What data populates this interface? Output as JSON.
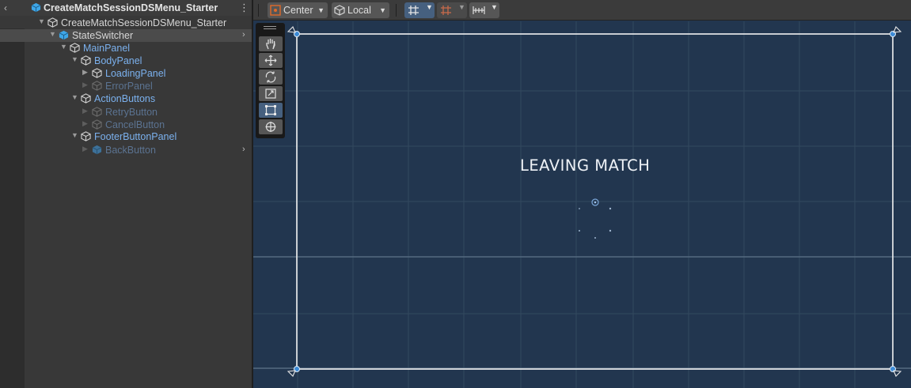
{
  "hierarchy": {
    "back_glyph": "‹",
    "title": "CreateMatchSessionDSMenu_Starter",
    "menu_glyph": "⋮",
    "rows": [
      {
        "label": "CreateMatchSessionDSMenu_Starter",
        "style": "white",
        "depth": 0,
        "prefab": false
      },
      {
        "label": "StateSwitcher",
        "style": "white",
        "depth": 1,
        "prefab": true,
        "selected": true
      },
      {
        "label": "MainPanel",
        "style": "blue",
        "depth": 2
      },
      {
        "label": "BodyPanel",
        "style": "blue",
        "depth": 3
      },
      {
        "label": "LoadingPanel",
        "style": "blue",
        "depth": 4
      },
      {
        "label": "ErrorPanel",
        "style": "dim",
        "depth": 4
      },
      {
        "label": "ActionButtons",
        "style": "blue",
        "depth": 3
      },
      {
        "label": "RetryButton",
        "style": "dim",
        "depth": 4
      },
      {
        "label": "CancelButton",
        "style": "dim",
        "depth": 4
      },
      {
        "label": "FooterButtonPanel",
        "style": "blue",
        "depth": 3
      },
      {
        "label": "BackButton",
        "style": "dim",
        "depth": 4,
        "prefab": true
      }
    ]
  },
  "toolbar": {
    "pivot_label": "Center",
    "space_label": "Local"
  },
  "tools": [
    "hand-tool-icon",
    "move-tool-icon",
    "rotate-tool-icon",
    "scale-tool-icon",
    "rect-tool-icon",
    "transform-tool-icon"
  ],
  "scene": {
    "heading": "LEAVING MATCH"
  },
  "colors": {
    "accent": "#3b8ad6",
    "scene_bg": "#22364f",
    "label_blue": "#7bb1ee",
    "label_dim": "#5b7391"
  }
}
